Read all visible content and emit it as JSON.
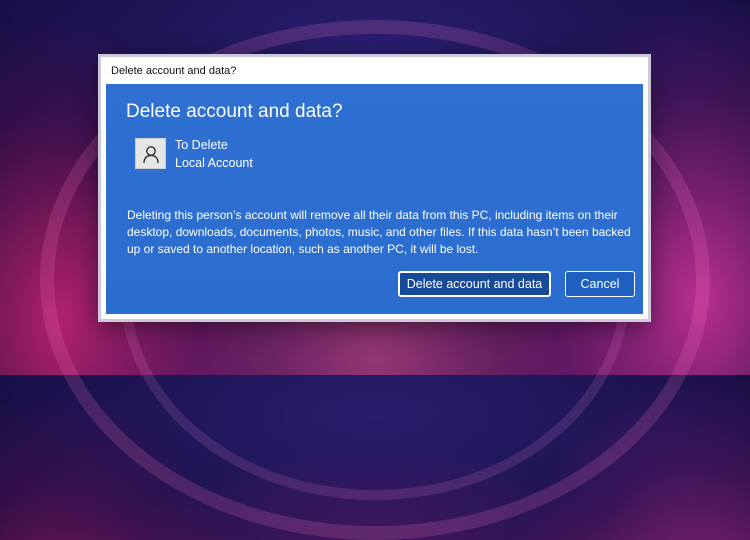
{
  "window": {
    "title": "Delete account and data?"
  },
  "dialog": {
    "heading": "Delete account and data?",
    "account": {
      "name": "To Delete",
      "type": "Local Account",
      "icon": "user-icon"
    },
    "message": "Deleting this person’s account will remove all their data from this PC, including items on their desktop, downloads, documents, photos, music, and other files. If this data hasn’t been backed up or saved to another location, such as another PC, it will be lost.",
    "buttons": {
      "primary_label": "Delete account and data",
      "cancel_label": "Cancel"
    }
  },
  "colors": {
    "panel_blue": "#2f6fd0",
    "primary_button": "#174a97",
    "text": "#ffffff"
  }
}
